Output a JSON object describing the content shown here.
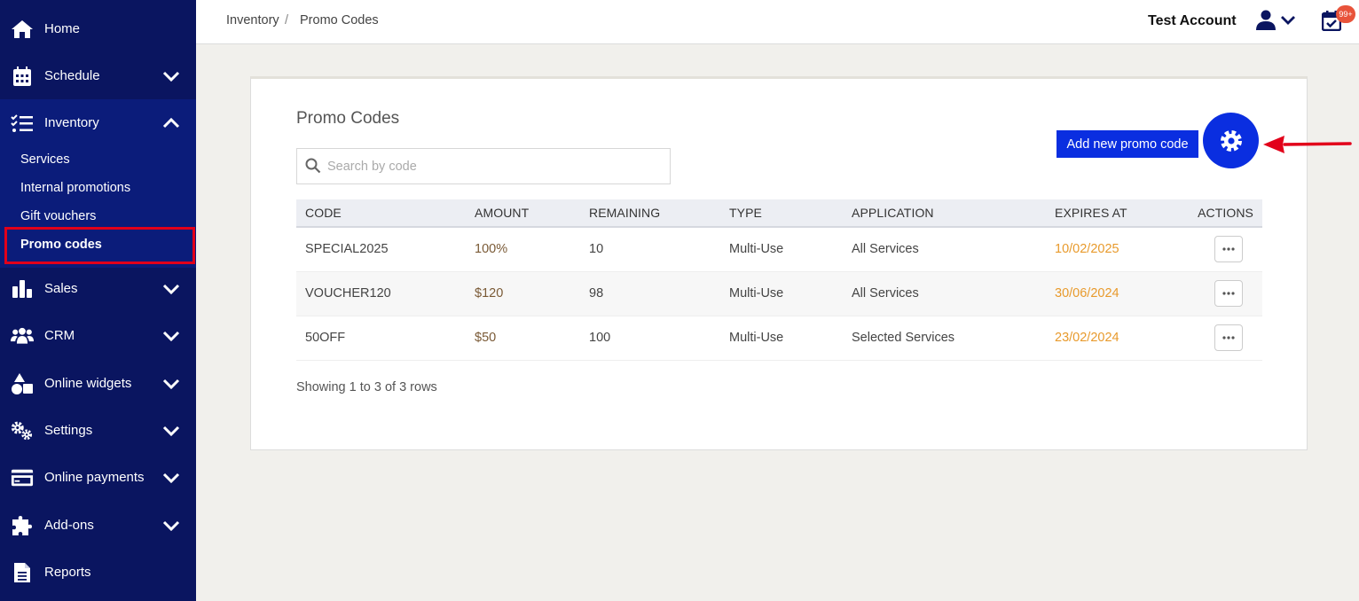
{
  "sidebar": {
    "items": [
      {
        "label": "Home",
        "icon": "home-icon"
      },
      {
        "label": "Schedule",
        "icon": "calendar-icon"
      },
      {
        "label": "Inventory",
        "icon": "checklist-icon"
      },
      {
        "label": "Sales",
        "icon": "bar-chart-icon"
      },
      {
        "label": "CRM",
        "icon": "users-icon"
      },
      {
        "label": "Online widgets",
        "icon": "shapes-icon"
      },
      {
        "label": "Settings",
        "icon": "gears-icon"
      },
      {
        "label": "Online payments",
        "icon": "credit-card-icon"
      },
      {
        "label": "Add-ons",
        "icon": "puzzle-icon"
      },
      {
        "label": "Reports",
        "icon": "document-icon"
      }
    ],
    "inventory_sub": [
      {
        "label": "Services"
      },
      {
        "label": "Internal promotions"
      },
      {
        "label": "Gift vouchers"
      },
      {
        "label": "Promo codes",
        "active": true
      }
    ]
  },
  "header": {
    "breadcrumb": [
      "Inventory",
      "Promo Codes"
    ],
    "separator": "/",
    "account": "Test Account",
    "badge": "99+"
  },
  "main": {
    "title": "Promo Codes",
    "search_placeholder": "Search by code",
    "add_button": "Add new promo code",
    "columns": [
      "CODE",
      "AMOUNT",
      "REMAINING",
      "TYPE",
      "APPLICATION",
      "EXPIRES AT",
      "ACTIONS"
    ],
    "rows": [
      {
        "code": "SPECIAL2025",
        "amount": "100%",
        "remaining": "10",
        "type": "Multi-Use",
        "application": "All Services",
        "expires": "10/02/2025"
      },
      {
        "code": "VOUCHER120",
        "amount": "$120",
        "remaining": "98",
        "type": "Multi-Use",
        "application": "All Services",
        "expires": "30/06/2024"
      },
      {
        "code": "50OFF",
        "amount": "$50",
        "remaining": "100",
        "type": "Multi-Use",
        "application": "Selected Services",
        "expires": "23/02/2024"
      }
    ],
    "footer": "Showing 1 to 3 of 3 rows"
  },
  "colors": {
    "sidebar_bg": "#0a1560",
    "accent": "#0a2ee0",
    "highlight": "#e2001a",
    "expires": "#e89a2c"
  }
}
